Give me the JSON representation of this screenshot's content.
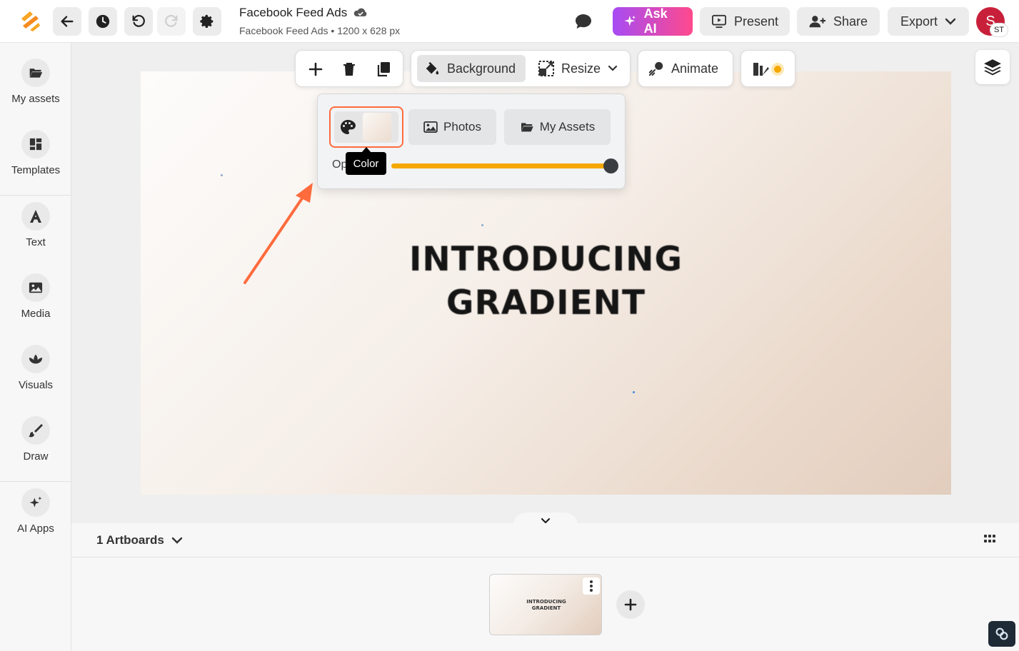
{
  "header": {
    "doc_title": "Facebook Feed Ads",
    "doc_subtitle": "Facebook Feed Ads • 1200 x 628 px",
    "ask_ai_label": "Ask AI",
    "present_label": "Present",
    "share_label": "Share",
    "export_label": "Export",
    "avatar_initial": "S",
    "avatar_badge": "ST"
  },
  "sidebar": {
    "items": [
      {
        "label": "My assets",
        "icon": "folder-icon"
      },
      {
        "label": "Templates",
        "icon": "templates-icon"
      },
      {
        "label": "Text",
        "icon": "text-icon"
      },
      {
        "label": "Media",
        "icon": "image-icon"
      },
      {
        "label": "Visuals",
        "icon": "lotus-icon"
      },
      {
        "label": "Draw",
        "icon": "brush-icon"
      },
      {
        "label": "AI Apps",
        "icon": "sparkle-icon"
      }
    ]
  },
  "toolbar": {
    "background_label": "Background",
    "resize_label": "Resize",
    "animate_label": "Animate"
  },
  "background_popover": {
    "photos_label": "Photos",
    "my_assets_label": "My Assets",
    "opacity_label": "Op",
    "opacity_percent": 100,
    "tooltip": "Color"
  },
  "artboard": {
    "headline_line1": "INTRODUCING",
    "headline_line2": "GRADIENT"
  },
  "bottom_panel": {
    "artboards_label": "1 Artboards",
    "thumb_line1": "INTRODUCING",
    "thumb_line2": "GRADIENT"
  },
  "colors": {
    "accent_orange": "#ff6b3d",
    "slider_fill": "#f5a800",
    "ask_ai_start": "#a64bf4",
    "ask_ai_end": "#ff4a8d",
    "avatar_bg": "#c8203a"
  }
}
